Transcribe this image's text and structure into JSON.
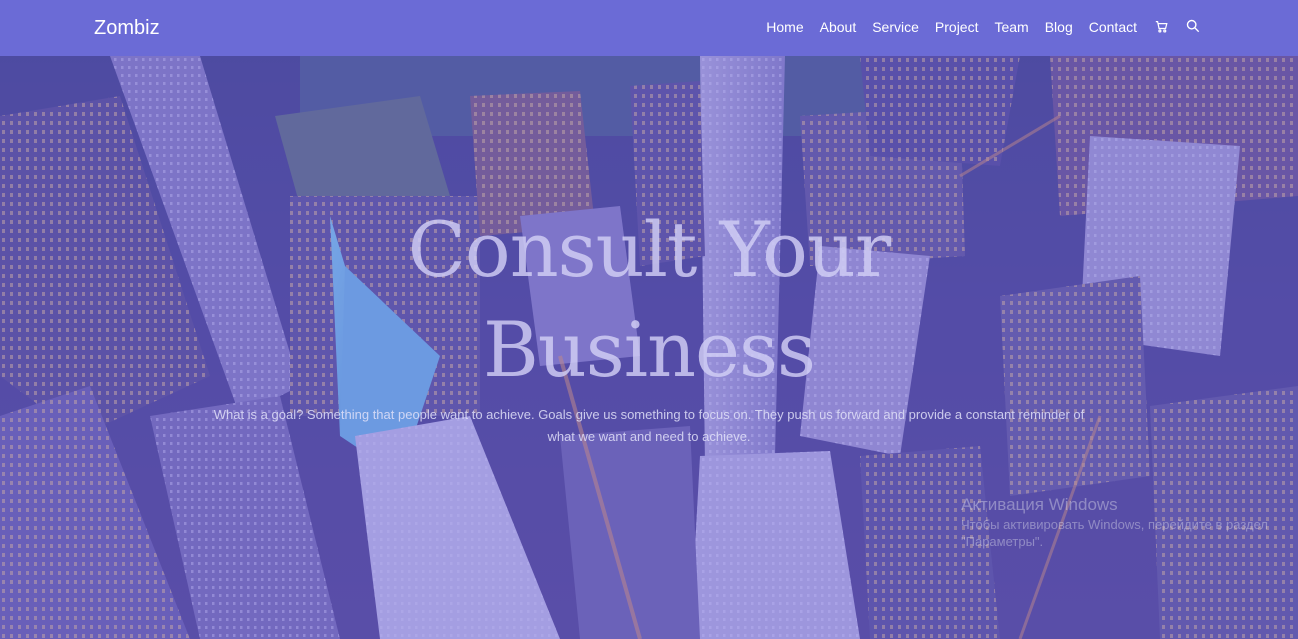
{
  "navbar": {
    "brand": "Zombiz",
    "links": [
      "Home",
      "About",
      "Service",
      "Project",
      "Team",
      "Blog",
      "Contact"
    ],
    "icons": [
      "cart-icon",
      "search-icon"
    ]
  },
  "hero": {
    "title": "Consult Your Business",
    "text": "What is a goal? Something that people want to achieve. Goals give us something to focus on. They push us forward and provide a constant reminder of what we want and need to achieve."
  },
  "watermark": {
    "title": "Активация Windows",
    "text": "Чтобы активировать Windows, перейдите в раздел \"Параметры\"."
  },
  "colors": {
    "navbar": "#6b6bd6",
    "overlay": "#6862d6",
    "text": "#ffffff"
  }
}
